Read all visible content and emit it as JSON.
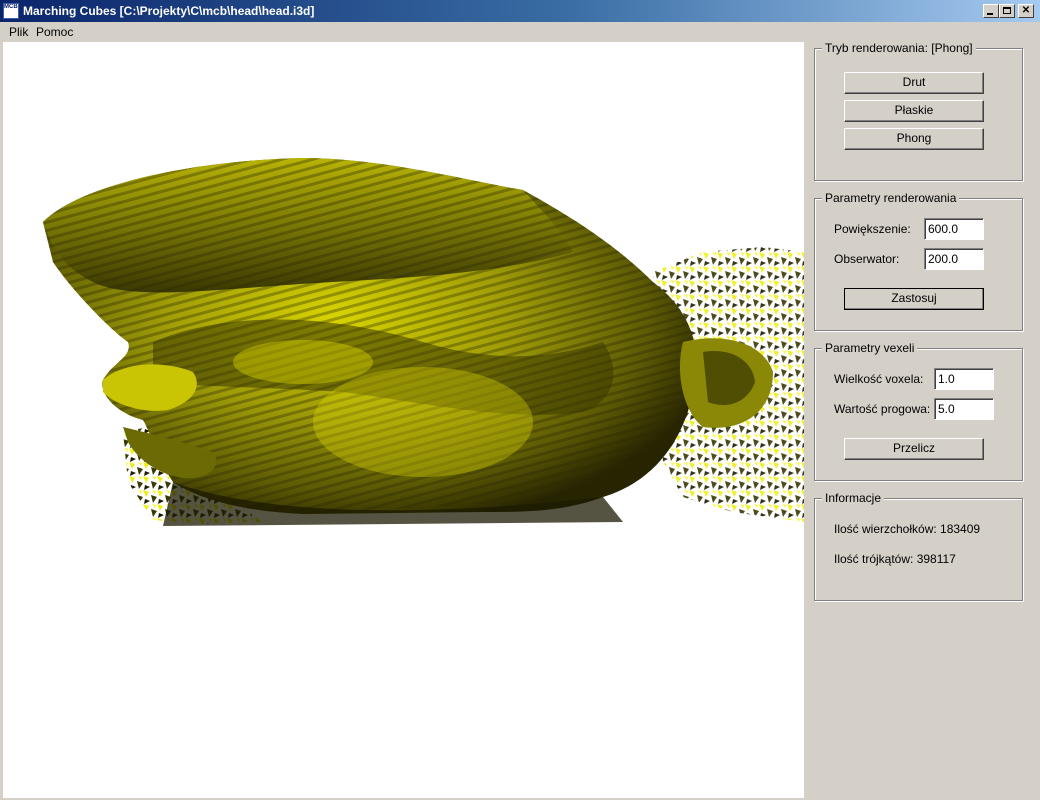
{
  "window": {
    "icon_text": "MCBD",
    "title": "Marching Cubes [C:\\Projekty\\C\\mcb\\head\\head.i3d]",
    "minimize_label": "",
    "maximize_label": "",
    "close_label": "✕"
  },
  "menu": [
    "Plik",
    "Pomoc"
  ],
  "render_mode": {
    "title": "Tryb renderowania: [Phong]",
    "buttons": [
      "Drut",
      "Płaskie",
      "Phong"
    ]
  },
  "render_params": {
    "title": "Parametry renderowania",
    "zoom_label": "Powiększenie:",
    "zoom_value": "600.0",
    "observer_label": "Obserwator:",
    "observer_value": "200.0",
    "apply_button": "Zastosuj"
  },
  "voxel_params": {
    "title": "Parametry vexeli",
    "voxel_size_label": "Wielkość voxela:",
    "voxel_size_value": "1.0",
    "threshold_label": "Wartość progowa:",
    "threshold_value": "5.0",
    "recalc_button": "Przelicz"
  },
  "info": {
    "title": "Informacje",
    "vertices": "Ilość wierzchołków: 183409",
    "triangles": "Ilość trójkątów: 398117"
  },
  "colors": {
    "surface_base": "#8f8e0c",
    "surface_highlight": "#f2f000",
    "surface_shadow": "#1c1a02",
    "title_gradient_start": "#0a246a",
    "title_gradient_end": "#a6caf0"
  }
}
